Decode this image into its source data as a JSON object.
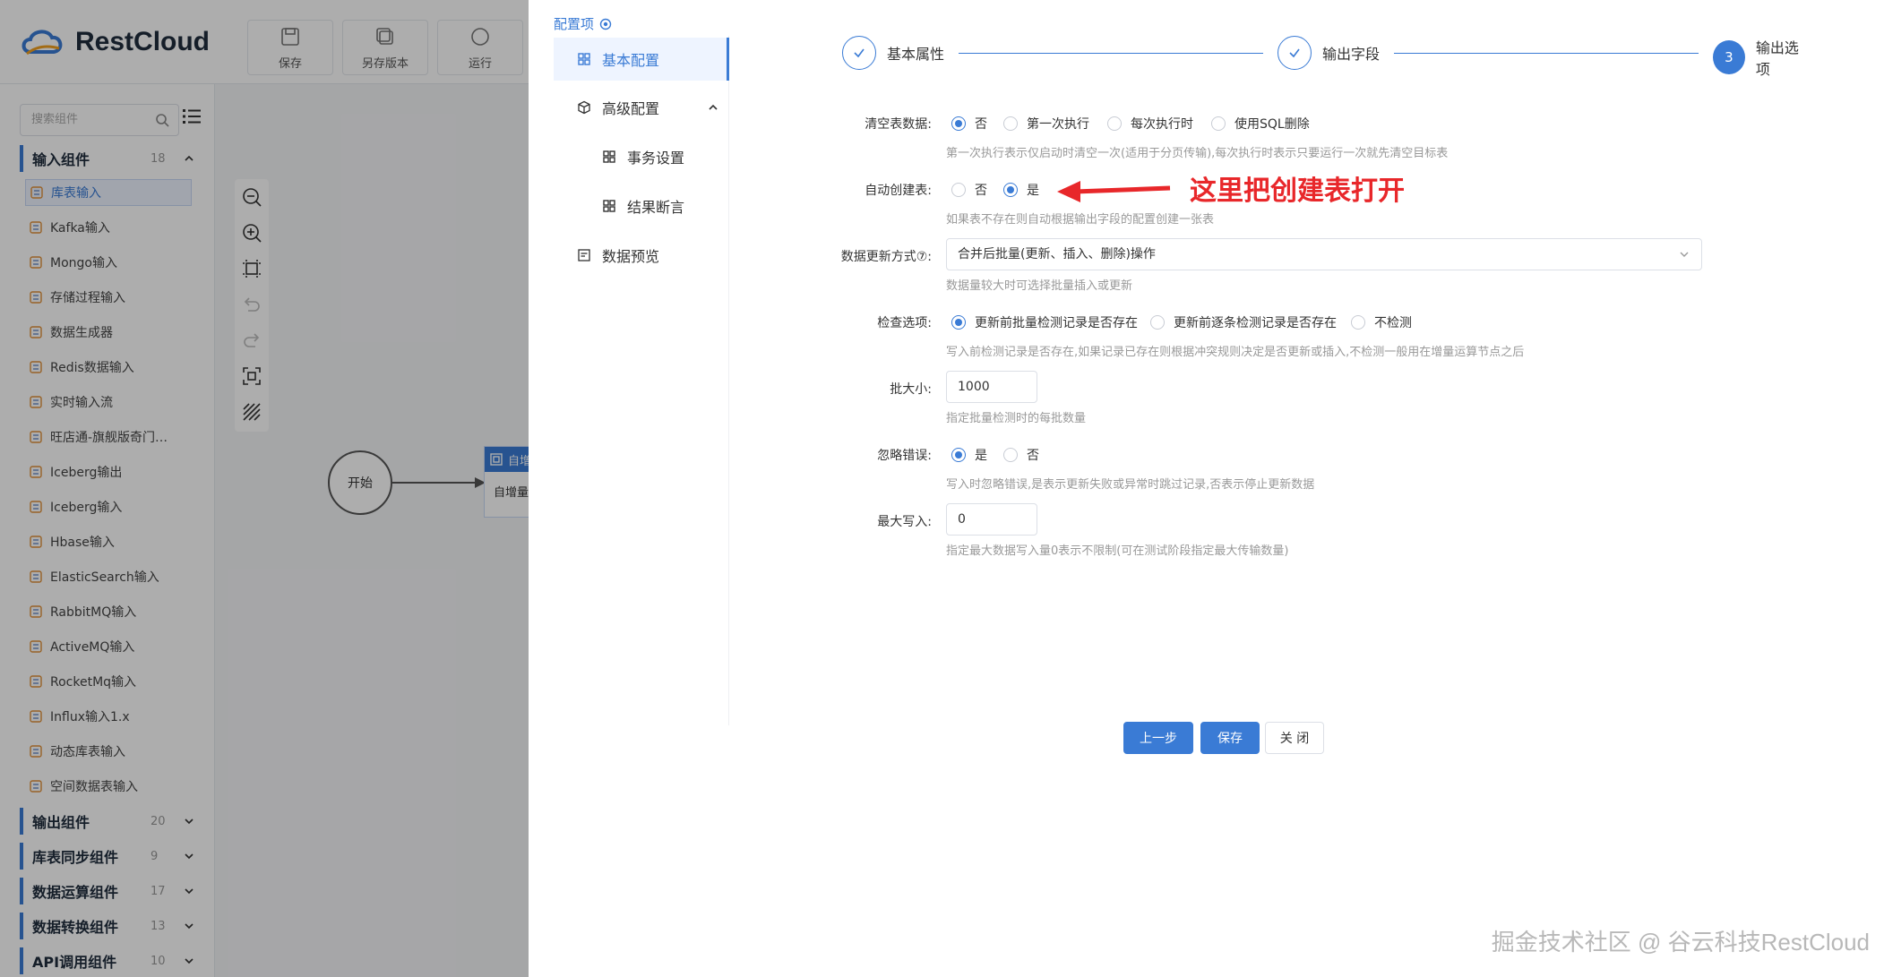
{
  "app": {
    "brand": "RestCloud",
    "toolbar": {
      "save": "保存",
      "save_version": "另存版本",
      "run": "运行"
    }
  },
  "sidebar": {
    "search_placeholder": "搜索组件",
    "categories": [
      {
        "label": "输入组件",
        "count": "18"
      },
      {
        "label": "输出组件",
        "count": "20"
      },
      {
        "label": "库表同步组件",
        "count": "9"
      },
      {
        "label": "数据运算组件",
        "count": "17"
      },
      {
        "label": "数据转换组件",
        "count": "13"
      },
      {
        "label": "API调用组件",
        "count": "10"
      }
    ],
    "input_items": [
      "库表输入",
      "Kafka输入",
      "Mongo输入",
      "存储过程输入",
      "数据生成器",
      "Redis数据输入",
      "实时输入流",
      "旺店通-旗舰版奇门…",
      "Iceberg输出",
      "Iceberg输入",
      "Hbase输入",
      "ElasticSearch输入",
      "RabbitMQ输入",
      "ActiveMQ输入",
      "RocketMq输入",
      "Influx输入1.x",
      "动态库表输入",
      "空间数据表输入"
    ]
  },
  "canvas": {
    "start_node": "开始",
    "node_head": "自增",
    "node_body": "自增量"
  },
  "drawer": {
    "config_label": "配置项",
    "nav": {
      "basic": "基本配置",
      "advanced": "高级配置",
      "transaction": "事务设置",
      "assert": "结果断言",
      "preview": "数据预览"
    },
    "steps": [
      {
        "label": "基本属性"
      },
      {
        "label": "输出字段"
      },
      {
        "num": "3",
        "label": "输出选项"
      }
    ],
    "form": {
      "clear_label": "清空表数据:",
      "clear_options": [
        "否",
        "第一次执行",
        "每次执行时",
        "使用SQL删除"
      ],
      "clear_hint": "第一次执行表示仅启动时清空一次(适用于分页传输),每次执行时表示只要运行一次就先清空目标表",
      "auto_label": "自动创建表:",
      "auto_options": [
        "否",
        "是"
      ],
      "auto_hint": "如果表不存在则自动根据输出字段的配置创建一张表",
      "update_label": "数据更新方式⑦:",
      "update_value": "合并后批量(更新、插入、删除)操作",
      "update_hint": "数据量较大时可选择批量插入或更新",
      "check_label": "检查选项:",
      "check_options": [
        "更新前批量检测记录是否存在",
        "更新前逐条检测记录是否存在",
        "不检测"
      ],
      "check_hint": "写入前检测记录是否存在,如果记录已存在则根据冲突规则决定是否更新或插入,不检测一般用在增量运算节点之后",
      "batch_label": "批大小:",
      "batch_value": "1000",
      "batch_hint": "指定批量检测时的每批数量",
      "ignore_label": "忽略错误:",
      "ignore_options": [
        "是",
        "否"
      ],
      "ignore_hint": "写入时忽略错误,是表示更新失败或异常时跳过记录,否表示停止更新数据",
      "max_label": "最大写入:",
      "max_value": "0",
      "max_hint": "指定最大数据写入量0表示不限制(可在测试阶段指定最大传输数量)"
    },
    "annotation": "这里把创建表打开",
    "buttons": {
      "prev": "上一步",
      "save": "保存",
      "close": "关 闭"
    }
  },
  "watermark": "掘金技术社区 @ 谷云科技RestCloud",
  "colors": {
    "primary": "#3a7bd5",
    "annotation": "#e8272a"
  }
}
